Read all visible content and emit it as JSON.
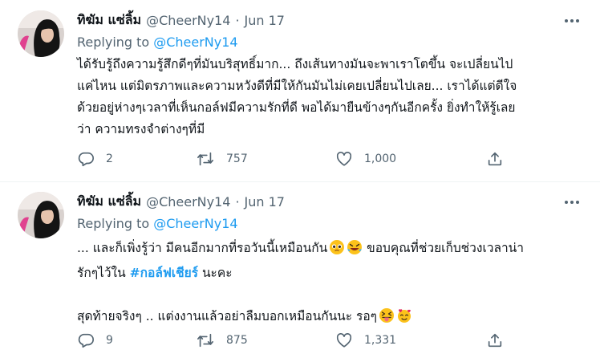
{
  "tweets": [
    {
      "display_name": "ทิฆัม แซ่ลิ้ม",
      "handle": "@CheerNy14",
      "separator": "·",
      "date": "Jun 17",
      "replying_to_label": "Replying to",
      "replying_to_handle": "@CheerNy14",
      "text_lines": [
        "ได้รับรู้ถึงความรู้สึกดีๆที่มันบริสุทธิ์มาก... ถึงเส้นทางมันจะพาเราโตขึ้น จะเปลี่ยนไป",
        "แค่ไหน แต่มิตรภาพและความหวังดีที่มีให้กันมันไม่เคยเปลี่ยนไปเลย... เราได้แต่ดีใจ",
        "ด้วยอยู่ห่างๆเวลาที่เห็นกอล์ฟมีความรักที่ดี พอได้มายืนข้างๆกันอีกครั้ง ยิ่งทำให้รู้เลย",
        "ว่า ความทรงจำต่างๆที่มี"
      ],
      "replies": "2",
      "retweets": "757",
      "likes": "1,000"
    },
    {
      "display_name": "ทิฆัม แซ่ลิ้ม",
      "handle": "@CheerNy14",
      "separator": "·",
      "date": "Jun 17",
      "replying_to_label": "Replying to",
      "replying_to_handle": "@CheerNy14",
      "line1": "... และก็เพิ่งรู้ว่า มีคนอีกมากที่รอวันนี้เหมือนกัน",
      "line1_after": " ขอบคุณที่ช่วยเก็บช่วงเวลาน่า",
      "line2_before": "รักๆไว้ใน ",
      "hashtag": "#กอล์ฟเชียร์",
      "line2_after": " นะคะ",
      "line3": "สุดท้ายจริงๆ .. แต่งงานแล้วอย่าลืมบอกเหมือนกันนะ รอๆ",
      "replies": "9",
      "retweets": "875",
      "likes": "1,331"
    }
  ],
  "icons": {
    "more": "more-horizontal-icon",
    "reply": "reply-bubble-icon",
    "retweet": "retweet-icon",
    "like": "heart-icon",
    "share": "share-icon",
    "emoji_pleading": "pleading-face-emoji",
    "emoji_laughing": "rolling-laughing-emoji",
    "emoji_tongue": "squinting-tongue-emoji",
    "emoji_hearts": "smiling-hearts-emoji"
  },
  "colors": {
    "link": "#1d9bf0",
    "secondary_text": "#536471",
    "primary_text": "#0f1419",
    "divider": "#eff3f4"
  }
}
